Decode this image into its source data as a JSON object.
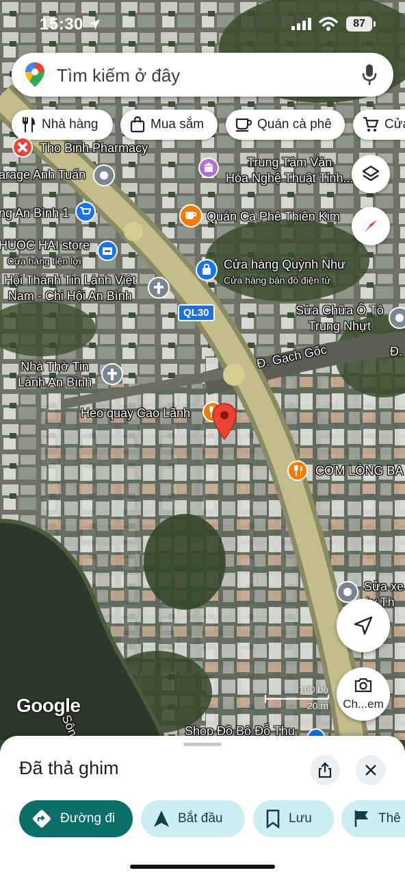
{
  "status": {
    "time": "15:30",
    "battery": "87"
  },
  "search": {
    "placeholder": "Tìm kiếm ở đây"
  },
  "chips": [
    {
      "label": "Nhà hàng",
      "icon": "fork-knife-icon"
    },
    {
      "label": "Mua sắm",
      "icon": "shopping-bag-icon"
    },
    {
      "label": "Quán cà phê",
      "icon": "coffee-cup-icon"
    },
    {
      "label": "Cửa",
      "icon": "shopping-cart-icon"
    }
  ],
  "map": {
    "road_badge": "QL30",
    "road_name": "Đ. Gạch Gốc",
    "road_name_cut": "Đ.",
    "pois": [
      {
        "name": "Tho Binh Pharmacy",
        "icon": "pharmacy-icon",
        "color": "#e8453c"
      },
      {
        "name": "arage Anh Tuấn",
        "icon": "pin-icon"
      },
      {
        "name": "Trung Tâm Văn",
        "name2": "Hóa Nghệ Thuật Tỉnh...",
        "icon": "museum-icon",
        "color": "#b26fd8"
      },
      {
        "name": "ng An Bình 1",
        "icon": "cart-icon",
        "color": "#1a73e8"
      },
      {
        "name": "Quán Cà Phê Thiên Kim",
        "icon": "coffee-icon",
        "color": "#f57c00"
      },
      {
        "name": "HUOC HAI store",
        "sub": "Cửa hàng tiện lợi",
        "icon": "store-icon",
        "color": "#1a73e8"
      },
      {
        "name": "Cửa hàng Quỳnh Như",
        "sub": "Cửa hàng bán đồ điện tử",
        "icon": "shopping-icon",
        "color": "#1a73e8"
      },
      {
        "name": "Hội Thánh Tin Lành Việt",
        "name2": "Nam - Chi Hội An Bình",
        "icon": "church-icon"
      },
      {
        "name": "Sửa Chữa Ô Tô",
        "name2": "Trung Nhựt",
        "icon": "pin-icon"
      },
      {
        "name": "Nhà Thờ Tin",
        "name2": "Lành An Bình",
        "icon": "church-icon"
      },
      {
        "name": "Heo quay Cao Lãnh",
        "icon": "restaurant-icon",
        "color": "#f57c00"
      },
      {
        "name": "CƠM LÒNG BA",
        "icon": "restaurant-icon",
        "color": "#f57c00"
      },
      {
        "name": "Sửa xe",
        "name2": "áy Th",
        "icon": "pin-icon"
      },
      {
        "name": "Shop Đồ Bộ Đỗ Thu",
        "icon": "shopping-icon",
        "color": "#1a73e8"
      }
    ],
    "river_label": "Sôn",
    "google": "Google",
    "scale_top": "100 bộ",
    "scale_bottom": "20 m",
    "camera_label": "Ch...em"
  },
  "sheet": {
    "title": "Đã thả ghim",
    "actions": [
      {
        "label": "Đường đi",
        "icon": "directions-icon",
        "bg": "#0b6e68",
        "fg": "#ffffff"
      },
      {
        "label": "Bắt đầu",
        "icon": "navigation-arrow-icon",
        "bg": "#cdeef0",
        "fg": "#11403f"
      },
      {
        "label": "Lưu",
        "icon": "bookmark-icon",
        "bg": "#cdeef0",
        "fg": "#11403f"
      },
      {
        "label": "Thê",
        "icon": "flag-icon",
        "bg": "#cdeef0",
        "fg": "#11403f"
      }
    ]
  }
}
